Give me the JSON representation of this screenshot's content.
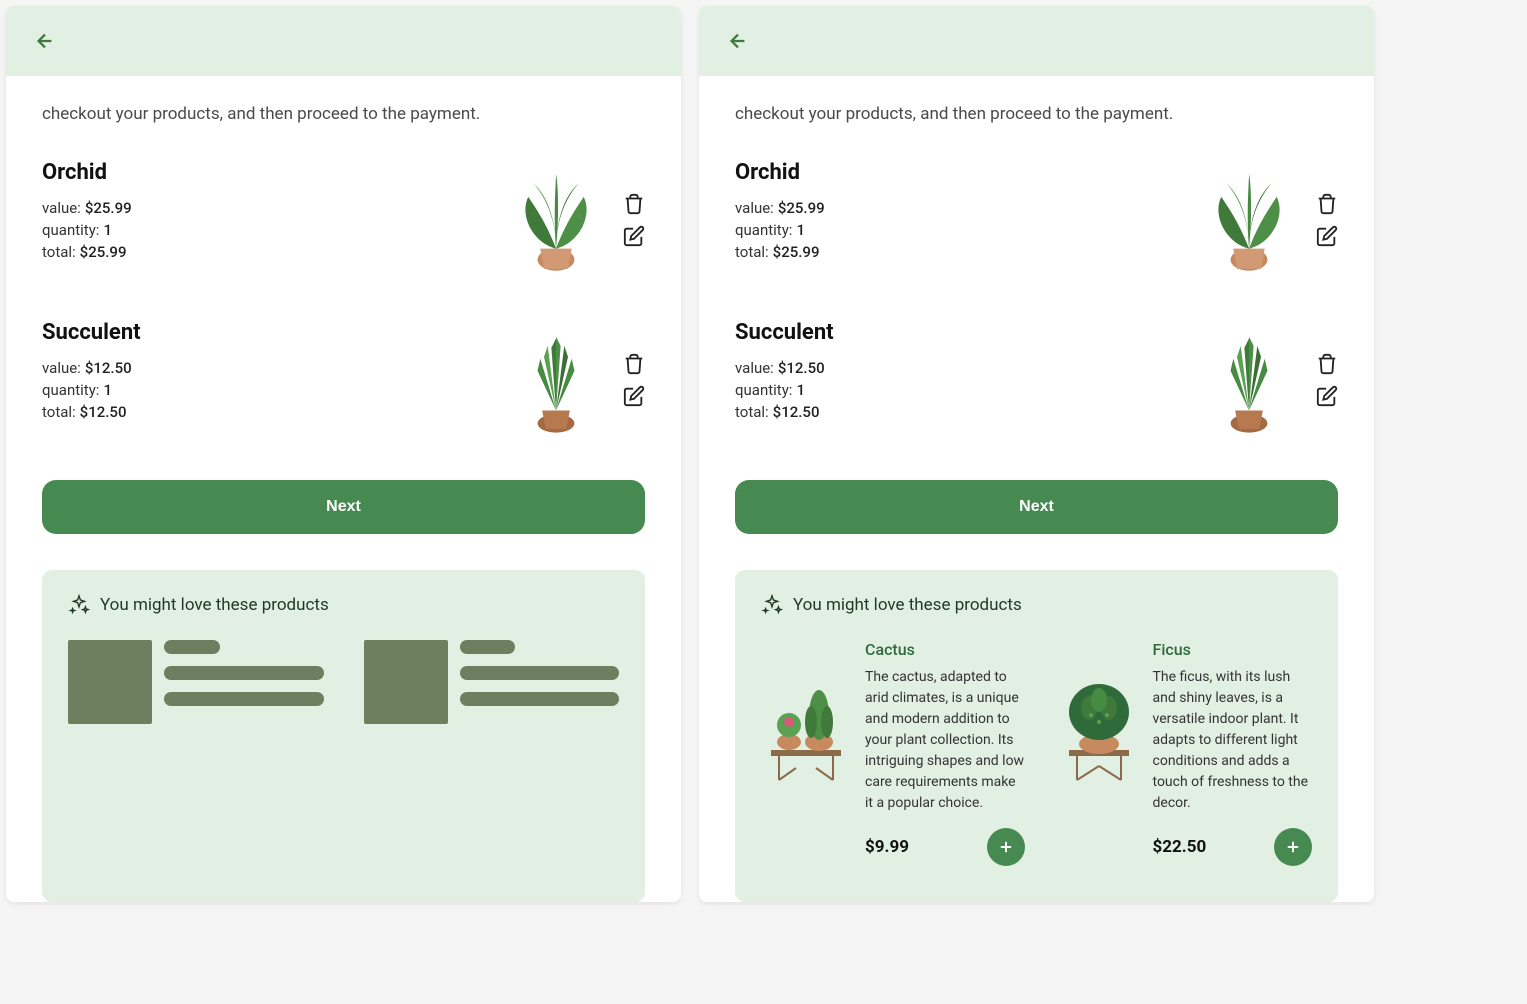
{
  "left": {
    "subtitle": "checkout your products, and then proceed to the payment.",
    "cart": [
      {
        "name": "Orchid",
        "value_label": "value:",
        "value": "$25.99",
        "qty_label": "quantity:",
        "qty": "1",
        "total_label": "total:",
        "total": "$25.99",
        "plant": "monstera"
      },
      {
        "name": "Succulent",
        "value_label": "value:",
        "value": "$12.50",
        "qty_label": "quantity:",
        "qty": "1",
        "total_label": "total:",
        "total": "$12.50",
        "plant": "snake"
      }
    ],
    "next_label": "Next",
    "recs_title": "You might love these products"
  },
  "right": {
    "subtitle": "checkout your products, and then proceed to the payment.",
    "cart": [
      {
        "name": "Orchid",
        "value_label": "value:",
        "value": "$25.99",
        "qty_label": "quantity:",
        "qty": "1",
        "total_label": "total:",
        "total": "$25.99",
        "plant": "monstera"
      },
      {
        "name": "Succulent",
        "value_label": "value:",
        "value": "$12.50",
        "qty_label": "quantity:",
        "qty": "1",
        "total_label": "total:",
        "total": "$12.50",
        "plant": "snake"
      }
    ],
    "next_label": "Next",
    "recs_title": "You might love these products",
    "recs": [
      {
        "name": "Cactus",
        "desc": "The cactus, adapted to arid climates, is a unique and modern addition to your plant collection. Its intriguing shapes and low care requirements make it a popular choice.",
        "price": "$9.99",
        "plant": "cactus"
      },
      {
        "name": "Ficus",
        "desc": "The ficus, with its lush and shiny leaves, is a versatile indoor plant. It adapts to different light conditions and adds a touch of freshness to the decor.",
        "price": "$22.50",
        "plant": "ficus"
      }
    ]
  }
}
